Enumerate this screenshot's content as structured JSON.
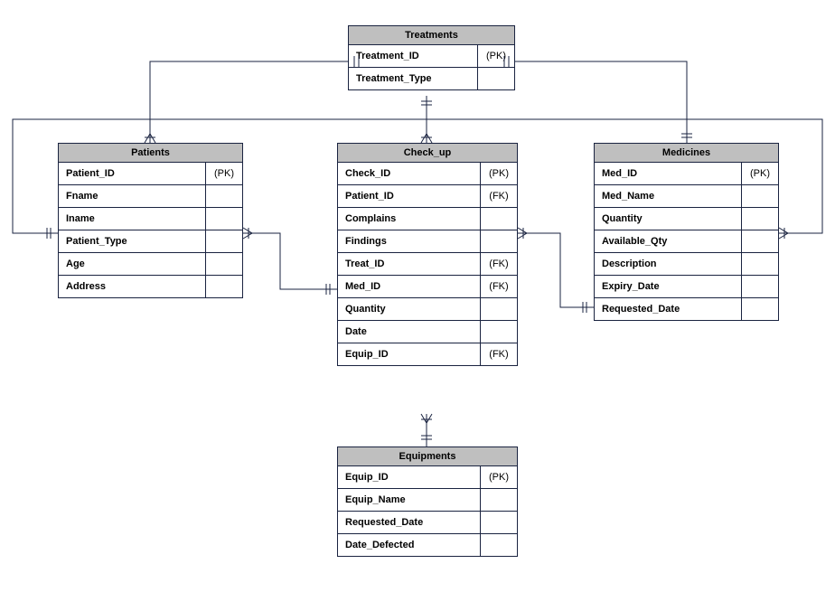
{
  "entities": {
    "treatments": {
      "title": "Treatments",
      "rows": [
        {
          "name": "Treatment_ID",
          "key": "(PK)"
        },
        {
          "name": "Treatment_Type",
          "key": ""
        }
      ]
    },
    "patients": {
      "title": "Patients",
      "rows": [
        {
          "name": "Patient_ID",
          "key": "(PK)"
        },
        {
          "name": "Fname",
          "key": ""
        },
        {
          "name": "Iname",
          "key": ""
        },
        {
          "name": "Patient_Type",
          "key": ""
        },
        {
          "name": "Age",
          "key": ""
        },
        {
          "name": "Address",
          "key": ""
        }
      ]
    },
    "checkup": {
      "title": "Check_up",
      "rows": [
        {
          "name": "Check_ID",
          "key": "(PK)"
        },
        {
          "name": "Patient_ID",
          "key": "(FK)"
        },
        {
          "name": "Complains",
          "key": ""
        },
        {
          "name": "Findings",
          "key": ""
        },
        {
          "name": "Treat_ID",
          "key": "(FK)"
        },
        {
          "name": "Med_ID",
          "key": "(FK)"
        },
        {
          "name": "Quantity",
          "key": ""
        },
        {
          "name": "Date",
          "key": ""
        },
        {
          "name": "Equip_ID",
          "key": "(FK)"
        }
      ]
    },
    "medicines": {
      "title": "Medicines",
      "rows": [
        {
          "name": "Med_ID",
          "key": "(PK)"
        },
        {
          "name": "Med_Name",
          "key": ""
        },
        {
          "name": "Quantity",
          "key": ""
        },
        {
          "name": "Available_Qty",
          "key": ""
        },
        {
          "name": "Description",
          "key": ""
        },
        {
          "name": "Expiry_Date",
          "key": ""
        },
        {
          "name": "Requested_Date",
          "key": ""
        }
      ]
    },
    "equipments": {
      "title": "Equipments",
      "rows": [
        {
          "name": "Equip_ID",
          "key": "(PK)"
        },
        {
          "name": "Equip_Name",
          "key": ""
        },
        {
          "name": "Requested_Date",
          "key": ""
        },
        {
          "name": "Date_Defected",
          "key": ""
        }
      ]
    }
  }
}
